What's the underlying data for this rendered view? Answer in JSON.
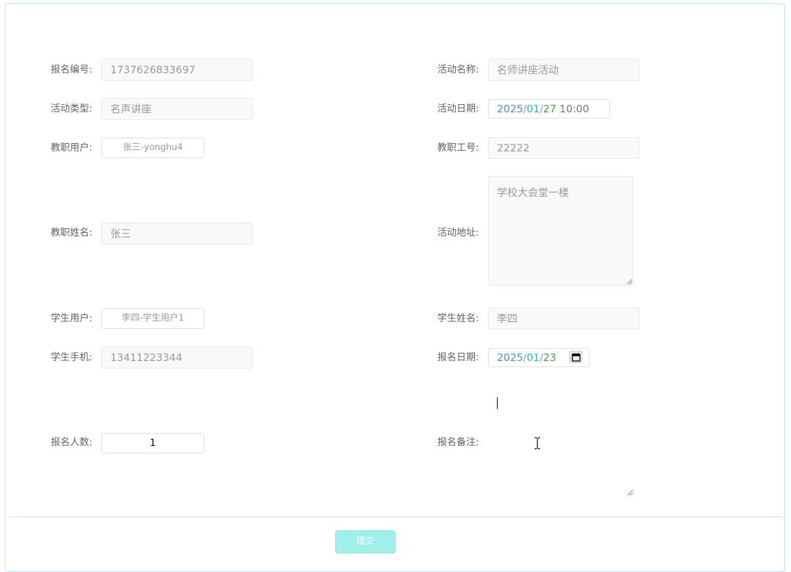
{
  "form": {
    "reg_no": {
      "label": "报名编号:",
      "value": "1737626833697"
    },
    "activity_name": {
      "label": "活动名称:",
      "value": "名师讲座活动"
    },
    "activity_type": {
      "label": "活动类型:",
      "value": "名声讲座"
    },
    "activity_date": {
      "label": "活动日期:",
      "year": "2025",
      "month": "01",
      "day": "27",
      "sep": "/",
      "time": "10:00"
    },
    "staff_user": {
      "label": "教职用户:",
      "value": "张三-yonghu4"
    },
    "staff_no": {
      "label": "教职工号:",
      "value": "22222"
    },
    "staff_name": {
      "label": "教职姓名:",
      "value": "张三"
    },
    "activity_address": {
      "label": "活动地址:",
      "value": "学校大会堂一楼"
    },
    "student_user": {
      "label": "学生用户:",
      "value": "李四-学生用户1"
    },
    "student_name": {
      "label": "学生姓名:",
      "value": "李四"
    },
    "student_phone": {
      "label": "学生手机:",
      "value": "13411223344"
    },
    "reg_date": {
      "label": "报名日期:",
      "year": "2025",
      "month": "01",
      "day": "23",
      "sep": "/"
    },
    "reg_count": {
      "label": "报名人数:",
      "value": "1"
    },
    "reg_remark": {
      "label": "报名备注:",
      "value": ""
    }
  },
  "submit_label": "提交",
  "icons": {
    "calendar": "calendar-icon"
  },
  "colors": {
    "accent": "#9ff0ea",
    "border": "#b3ecf2"
  }
}
